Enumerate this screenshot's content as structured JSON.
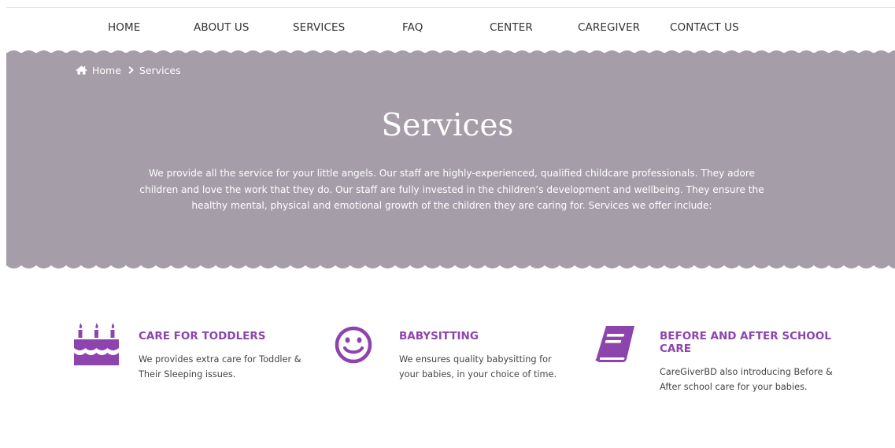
{
  "nav": {
    "items": [
      {
        "label": "HOME"
      },
      {
        "label": "ABOUT US"
      },
      {
        "label": "SERVICES"
      },
      {
        "label": "FAQ"
      },
      {
        "label": "CENTER"
      },
      {
        "label": "CAREGIVER"
      },
      {
        "label": "CONTACT US"
      }
    ]
  },
  "breadcrumb": {
    "home_label": "Home",
    "current_label": "Services",
    "home_icon": "home-icon",
    "separator_icon": "chevron-right-icon"
  },
  "hero": {
    "title": "Services",
    "description": "We provide all the service for your little angels. Our staff are highly-experienced, qualified childcare professionals. They adore children and love the work that they do. Our staff are fully invested in the children’s development and wellbeing. They ensure the healthy mental, physical and emotional growth of the children they are caring for. Services we offer include:",
    "background_color": "#a59ea8"
  },
  "services": [
    {
      "icon": "birthday-cake-icon",
      "title": "CARE FOR TODDLERS",
      "description": "We provides extra care for Toddler & Their Sleeping issues."
    },
    {
      "icon": "smile-icon",
      "title": "BABYSITTING",
      "description": "We ensures quality babysitting for your babies, in your choice of time."
    },
    {
      "icon": "book-icon",
      "title": "BEFORE AND AFTER SCHOOL CARE",
      "description": "CareGiverBD also introducing Before & After school care for your babies."
    }
  ],
  "colors": {
    "accent": "#8e44ad",
    "hero_bg": "#a59ea8",
    "text": "#333333"
  }
}
